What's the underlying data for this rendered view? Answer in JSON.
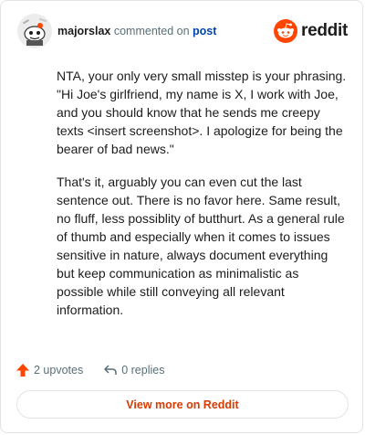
{
  "header": {
    "username": "majorslax",
    "action_text": " commented on ",
    "post_link": "post",
    "logo_text": "reddit"
  },
  "comment": {
    "paragraphs": [
      "NTA, your only very small misstep is your phrasing. \"Hi Joe's girlfriend, my name is X, I work with Joe, and you should know that he sends me creepy texts <insert screenshot>. I apologize for being the bearer of bad news.\"",
      "That's it, arguably you can even cut the last sentence out. There is no favor here. Same result, no fluff, less possiblity of butthurt. As a general rule of thumb and especially when it comes to issues sensitive in nature, always document everything but keep communication as minimalistic as possible while still conveying all relevant information."
    ]
  },
  "actions": {
    "upvotes": "2 upvotes",
    "replies": "0 replies"
  },
  "footer": {
    "view_more_label": "View more on Reddit"
  },
  "colors": {
    "reddit_orange": "#ff4500",
    "view_more_text": "#d93a00",
    "post_link": "#0045ac",
    "meta_gray": "#576f76"
  },
  "icons": {
    "avatar": "snoo-avatar-icon",
    "logo": "reddit-snoo-icon",
    "upvote": "upvote-arrow-icon",
    "reply": "reply-arrow-icon"
  }
}
